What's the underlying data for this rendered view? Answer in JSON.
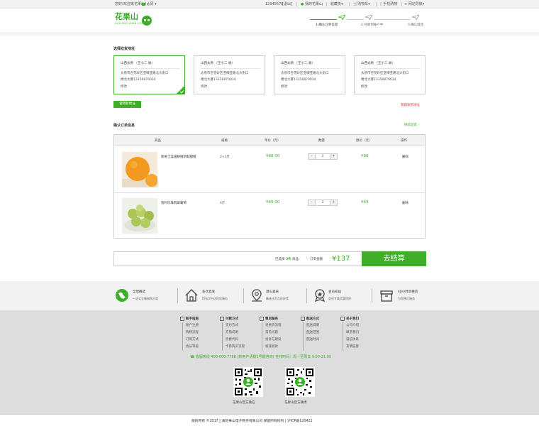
{
  "topbar": {
    "welcome": "您好!欢迎来花果山！",
    "city": "太原",
    "phone": "12345678",
    "logout": "[退出]",
    "my_account": "我的花果山",
    "favorites": "收藏夹",
    "cart": "购物车",
    "mobile": "手机购物",
    "site_nav": "网站导航"
  },
  "header": {
    "logo_cn": "花果山",
    "logo_en": "HUA-GUO-SHAN.COM",
    "steps": [
      "1.确认订单信息",
      "2.付款到账户中",
      "3.确认收货"
    ]
  },
  "address": {
    "title": "选择收货地址",
    "cards": [
      {
        "name": "山西太原 （王小二 收）",
        "line1": "太原市杏花岭区亚细亚路北大街口",
        "line2": "楼北大厦13356879034",
        "edit": "修改",
        "selected": true
      },
      {
        "name": "山西太原 （王小二 收）",
        "line1": "太原市杏花岭区亚细亚路北大街口",
        "line2": "楼北大厦13356879034",
        "edit": "修改",
        "selected": false
      },
      {
        "name": "山西太原 （王小二 收）",
        "line1": "太原市杏花岭区亚细亚路北大街口",
        "line2": "楼北大厦13356879034",
        "edit": "修改",
        "selected": false
      },
      {
        "name": "山西太原 （王小二 收）",
        "line1": "太原市杏花岭区亚细亚路北大街口",
        "line2": "楼北大厦13356879034",
        "edit": "修改",
        "selected": false
      }
    ],
    "new_button": "使用新地址",
    "manage_link": "管理收货地址"
  },
  "order": {
    "title": "确认订单信息",
    "continue_link": "继续逛逛",
    "headers": [
      "商品",
      "规格",
      "单价（元）",
      "数量",
      "原价（元）",
      "操作"
    ],
    "items": [
      {
        "name": "新奇士美国脐橙新鲜甜橙",
        "spec": "2+1斤",
        "price": "¥88.00",
        "qty": "1",
        "orig": "¥88",
        "action": "删除"
      },
      {
        "name": "智利珍珠翡翠葡萄",
        "spec": "4斤",
        "price": "¥49.00",
        "qty": "1",
        "orig": "¥49",
        "action": "删除"
      }
    ]
  },
  "summary": {
    "selected_prefix": "已选择",
    "count": "3件",
    "selected_suffix": "商品",
    "divider": "|",
    "amount_label": "订单金额",
    "total": "¥137",
    "checkout": "去结算"
  },
  "features": [
    {
      "title": "全球精选",
      "sub": "一站式全服网购方案",
      "icon": "globe-icon"
    },
    {
      "title": "多仓直发",
      "sub": "特有次日达时效服务",
      "icon": "house-icon"
    },
    {
      "title": "源头直采",
      "sub": "精选正宗品质好食",
      "icon": "location-pin-icon"
    },
    {
      "title": "会员权益",
      "sub": "会员专属优惠特权",
      "icon": "medal-icon"
    },
    {
      "title": "48小时退换货",
      "sub": "为您售后服务",
      "icon": "box-icon"
    }
  ],
  "footer": {
    "columns": [
      {
        "title": "新手指南",
        "items": [
          "账户注册",
          "购物流程",
          "订购方式",
          "会员等级"
        ]
      },
      {
        "title": "付款方式",
        "items": [
          "支付方式",
          "充值说明",
          "优惠代码",
          "卡券购买流程"
        ]
      },
      {
        "title": "售后服务",
        "items": [
          "退换货流程",
          "常见问题",
          "投诉与建议",
          "极速退款"
        ]
      },
      {
        "title": "配送方式",
        "items": [
          "配送说明",
          "配送范围",
          "配送时间"
        ]
      },
      {
        "title": "关于我们",
        "items": [
          "公司介绍",
          "联系我们",
          "诚信体系",
          "友情链接"
        ]
      }
    ],
    "hotline": "客服热线 400-000-7788 (新用户请拨2号键咨询) 在线时间：周一至周日 9:00-21:00",
    "qr_labels": [
      "花果山官方微信",
      "花果山官方微博"
    ],
    "copyright": "版权所有 ©2017上海花果山电子商务有限公司  保留所有权利 | 沪ICP备120421"
  },
  "colors": {
    "brand_green": "#3fae29",
    "link_red": "#d9363e",
    "footer_bg": "#dddddd"
  }
}
